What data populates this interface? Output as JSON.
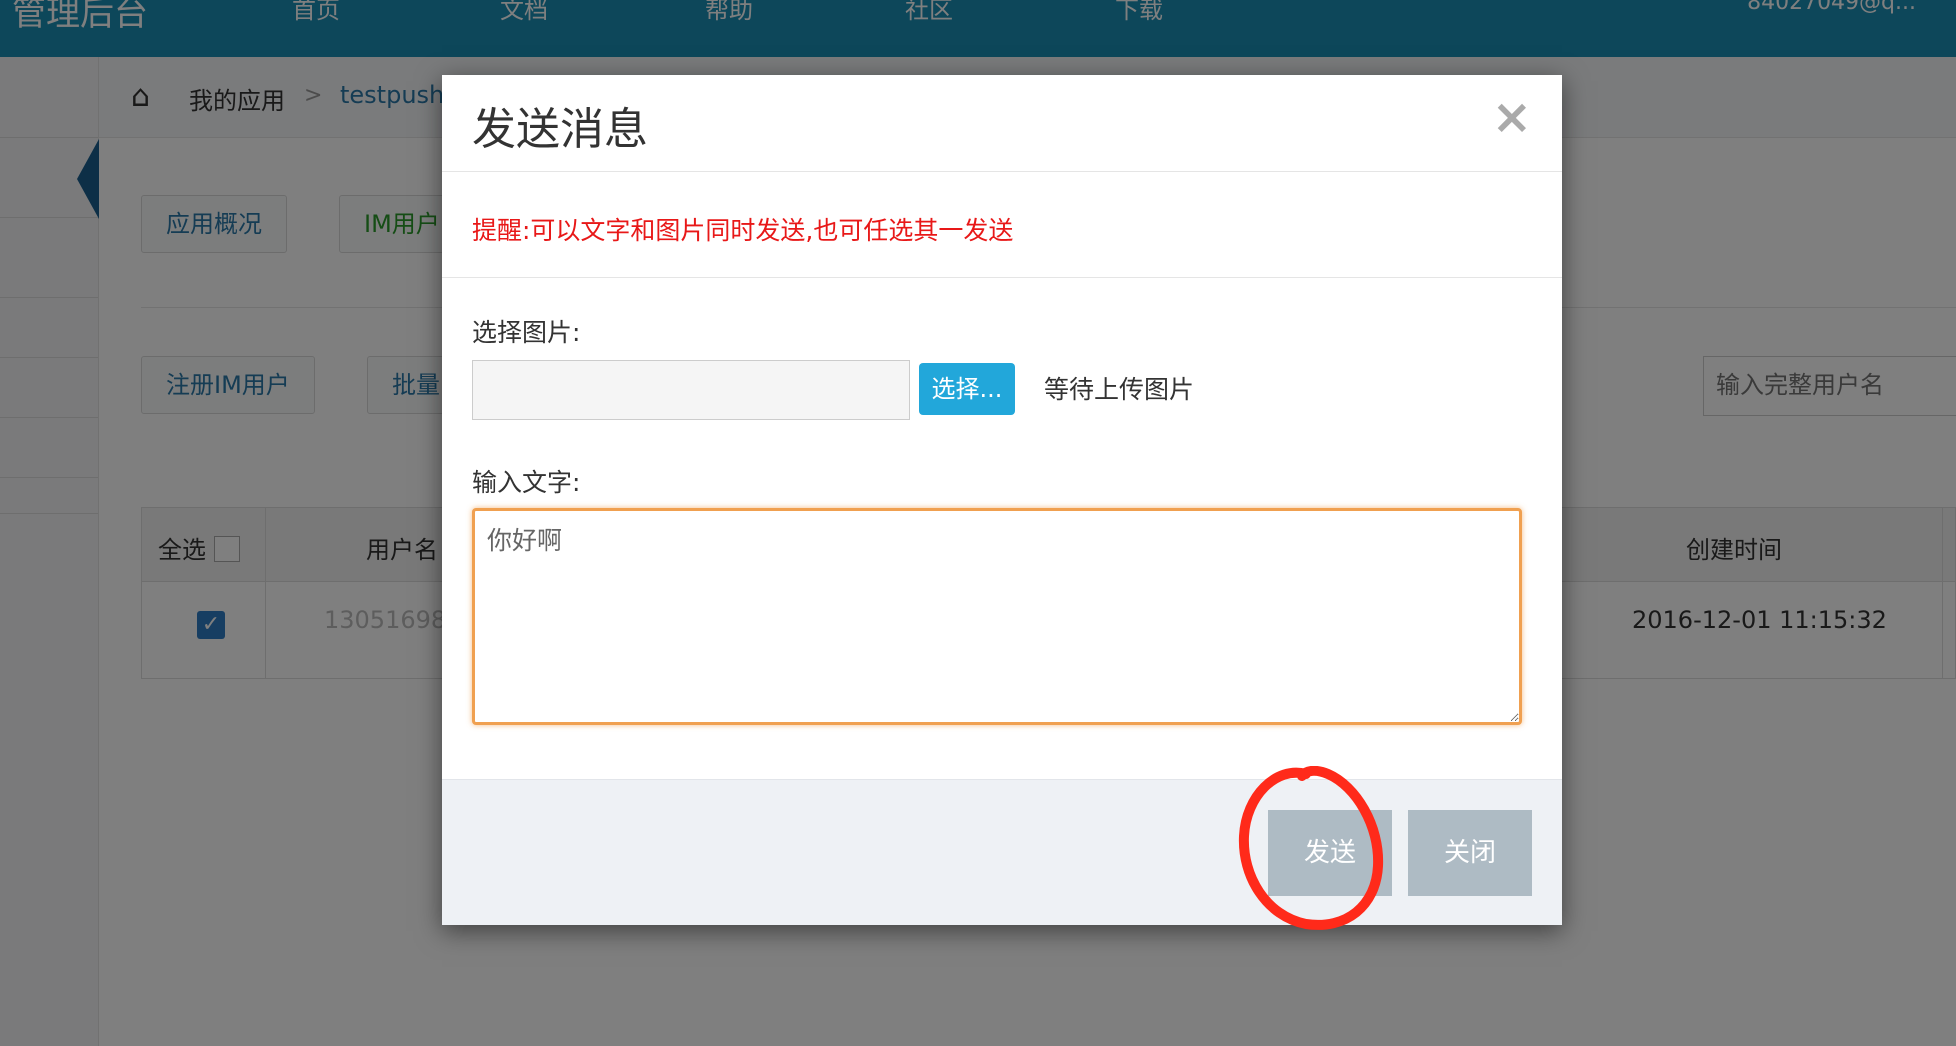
{
  "topbar": {
    "brand": "管理后台",
    "nav": [
      "首页",
      "文档",
      "帮助",
      "社区",
      "下载"
    ],
    "user": "84027049@q..."
  },
  "breadcrumb": {
    "app": "我的应用",
    "sep": ">",
    "current": "testpush"
  },
  "tabs": {
    "overview": "应用概况",
    "im_users": "IM用户"
  },
  "actions": {
    "register": "注册IM用户",
    "batch": "批量"
  },
  "search": {
    "placeholder": "输入完整用户名"
  },
  "table": {
    "headers": {
      "select_all": "全选",
      "username": "用户名",
      "created": "创建时间"
    },
    "rows": [
      {
        "checked": true,
        "username": "13051698",
        "created": "2016-12-01 11:15:32"
      }
    ]
  },
  "modal": {
    "title": "发送消息",
    "close_icon": "×",
    "hint": "提醒:可以文字和图片同时发送,也可任选其一发送",
    "image_label": "选择图片:",
    "choose_button": "选择...",
    "upload_status": "等待上传图片",
    "text_label": "输入文字:",
    "text_value": "你好啊",
    "send_button": "发送",
    "close_button": "关闭"
  },
  "colors": {
    "topbar": "#1a8fb5",
    "hint_red": "#e81818",
    "choose_blue": "#22a7da",
    "textarea_focus": "#f0a050",
    "footer_button": "#aebbc4",
    "annotation_red": "#ff2a1a"
  }
}
